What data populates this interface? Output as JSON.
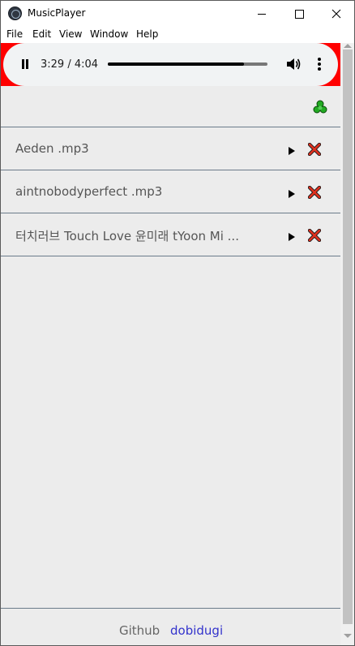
{
  "window": {
    "title": "MusicPlayer"
  },
  "menu": {
    "items": [
      "File",
      "Edit",
      "View",
      "Window",
      "Help"
    ]
  },
  "player": {
    "time_display": "3:29 / 4:04",
    "current_time": "3:29",
    "duration": "4:04",
    "progress_fraction": 0.855,
    "playing": true,
    "accent_color": "#ff0000"
  },
  "playlist": {
    "tracks": [
      {
        "name": "Aeden .mp3"
      },
      {
        "name": "aintnobodyperfect .mp3"
      },
      {
        "name": "터치러브 Touch Love 윤미래 tYoon Mi ..."
      }
    ]
  },
  "icons": {
    "recycle": "recycle-icon",
    "play": "play-icon",
    "delete": "close-x-icon",
    "volume": "volume-icon",
    "more": "more-vertical-icon",
    "pause": "pause-icon"
  },
  "footer": {
    "github_label": "Github",
    "user_link": "dobidugi",
    "link_color": "#3333cc"
  }
}
